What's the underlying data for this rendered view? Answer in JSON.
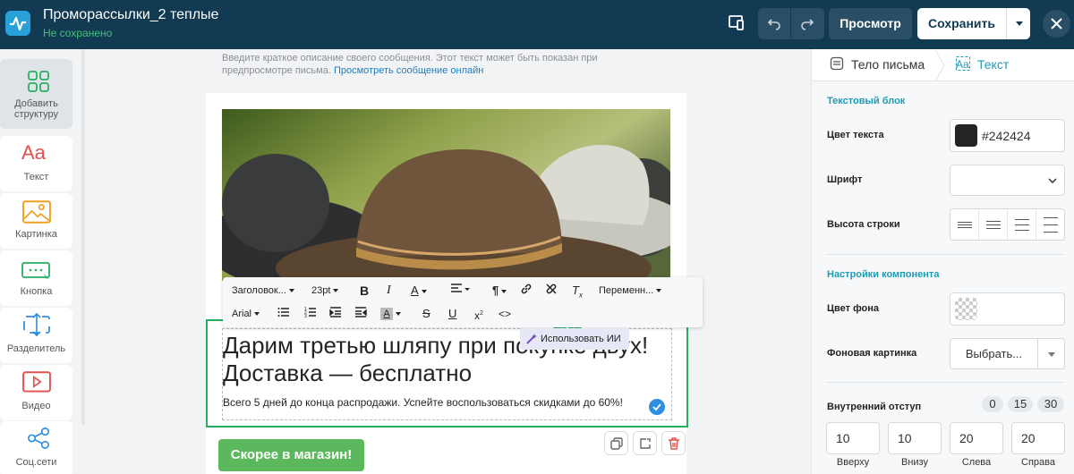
{
  "header": {
    "title": "Проморассылки_2 теплые",
    "status": "Не сохранено",
    "preview_label": "Просмотр",
    "save_label": "Сохранить"
  },
  "tools": [
    {
      "label": "Добавить структуру",
      "icon": "grid-icon"
    },
    {
      "label": "Текст",
      "icon": "text-icon"
    },
    {
      "label": "Картинка",
      "icon": "image-icon"
    },
    {
      "label": "Кнопка",
      "icon": "button-icon"
    },
    {
      "label": "Разделитель",
      "icon": "divider-icon"
    },
    {
      "label": "Видео",
      "icon": "video-icon"
    },
    {
      "label": "Соц.сети",
      "icon": "share-icon"
    }
  ],
  "canvas": {
    "preheader_text": "Введите краткое описание своего сообщения. Этот текст может быть показан при предпросмотре письма.",
    "preheader_link": "Просмотреть сообщение онлайн",
    "heading": "Дарим третью шляпу при покупке двух! Доставка — бесплатно",
    "subtext": "Всего 5 дней до конца распродажи. Успейте воспользоваться скидками до 60%!",
    "cta_label": "Скорее в магазин!"
  },
  "format_toolbar": {
    "style": "Заголовок...",
    "size": "23pt",
    "variables": "Переменн...",
    "font": "Arial",
    "ai_label": "Использовать ИИ"
  },
  "panel": {
    "tab_body": "Тело письма",
    "tab_text": "Текст",
    "section_text_block": "Текстовый блок",
    "text_color_label": "Цвет текста",
    "text_color_value": "#242424",
    "font_label": "Шрифт",
    "line_height_label": "Высота строки",
    "section_component": "Настройки компонента",
    "bg_color_label": "Цвет фона",
    "bg_image_label": "Фоновая картинка",
    "bg_image_button": "Выбрать...",
    "padding_label": "Внутренний отступ",
    "padding_presets": [
      "0",
      "15",
      "30"
    ],
    "padding_values": {
      "top": "10",
      "bottom": "10",
      "left": "20",
      "right": "20"
    },
    "padding_labels": {
      "top": "Вверху",
      "bottom": "Внизу",
      "left": "Слева",
      "right": "Справа"
    }
  },
  "colors": {
    "topbar": "#123a52",
    "accent_green": "#27ae60",
    "cta": "#5cb85c",
    "panel_accent": "#1d9bb5"
  }
}
